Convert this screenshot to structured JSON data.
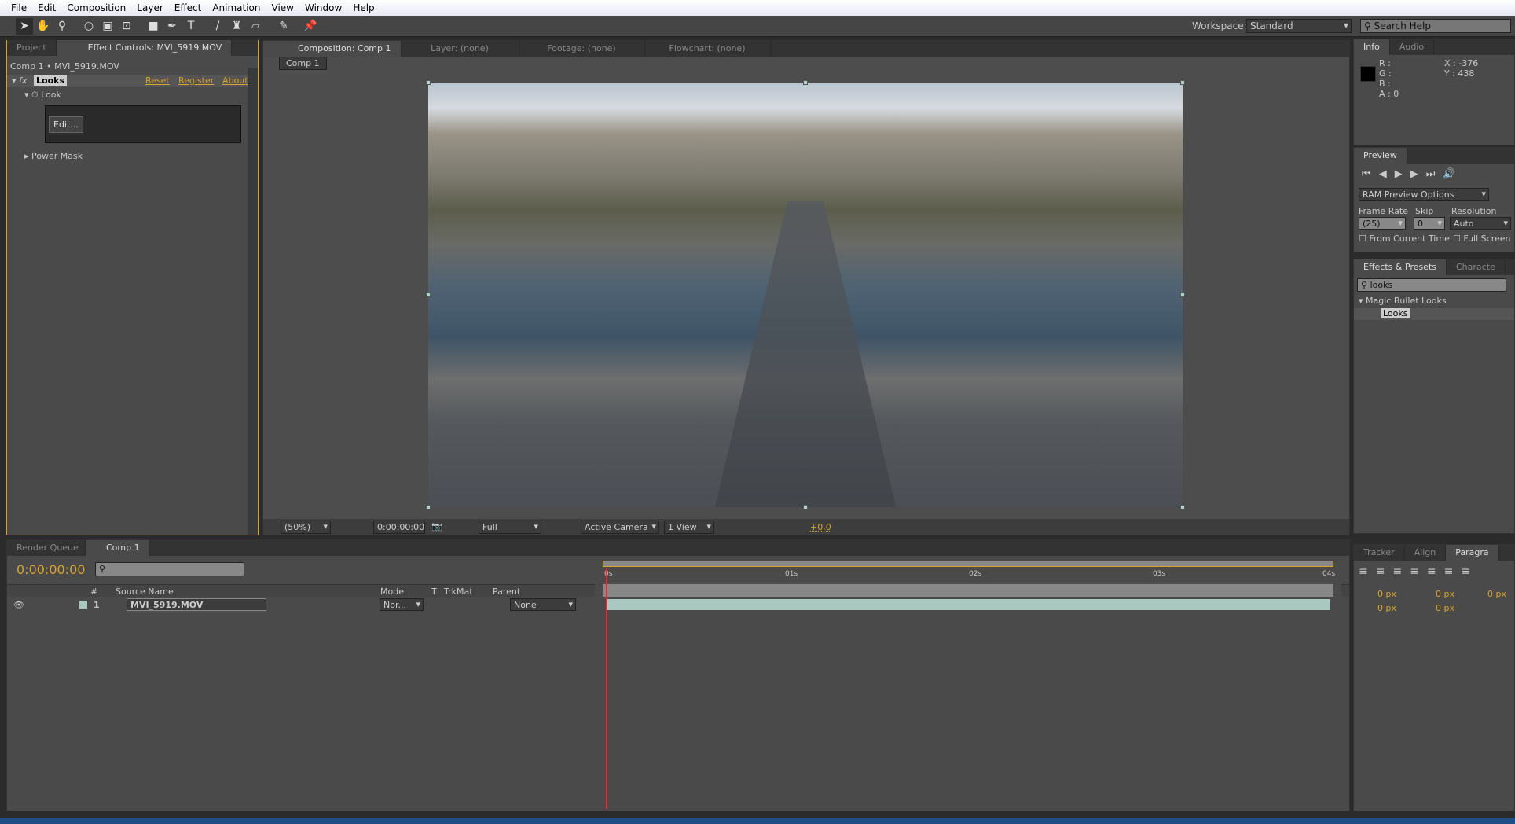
{
  "menu": [
    "File",
    "Edit",
    "Composition",
    "Layer",
    "Effect",
    "Animation",
    "View",
    "Window",
    "Help"
  ],
  "toolbar": {
    "tools": [
      "selection-tool",
      "hand-tool",
      "zoom-tool",
      "rotate-tool",
      "camera-tool",
      "pan-behind-tool",
      "rectangle-tool",
      "pen-tool",
      "type-tool",
      "brush-tool",
      "clone-stamp-tool",
      "eraser-tool",
      "roto-brush-tool",
      "puppet-pin-tool"
    ],
    "workspace_label": "Workspace:",
    "workspace_value": "Standard",
    "search_placeholder": "Search Help"
  },
  "effect_controls": {
    "tabs": [
      "Project",
      "Effect Controls: MVI_5919.MOV"
    ],
    "breadcrumb": "Comp 1 • MVI_5919.MOV",
    "effect_name": "Looks",
    "reset": "Reset",
    "register": "Register",
    "about": "About",
    "look_label": "Look",
    "edit_button": "Edit...",
    "power_mask": "Power Mask"
  },
  "composition": {
    "tabs": [
      "Composition: Comp 1",
      "Layer: (none)",
      "Footage: (none)",
      "Flowchart: (none)"
    ],
    "comp_chip": "Comp 1",
    "zoom": "(50%)",
    "timecode": "0:00:00:00",
    "resolution": "Full",
    "camera": "Active Camera",
    "views": "1 View",
    "exposure": "+0,0"
  },
  "info": {
    "tabs": [
      "Info",
      "Audio"
    ],
    "r": "R :",
    "g": "G :",
    "b": "B :",
    "a": "A : 0",
    "x": "X : -376",
    "y": "Y : 438",
    "swatch_color": "#000000"
  },
  "preview": {
    "tab": "Preview",
    "ram_options": "RAM Preview Options",
    "frame_rate_label": "Frame Rate",
    "skip_label": "Skip",
    "resolution_label": "Resolution",
    "frame_rate": "(25)",
    "skip": "0",
    "resolution": "Auto",
    "from_current_time": "From Current Time",
    "full_screen": "Full Screen"
  },
  "effects_presets": {
    "tabs": [
      "Effects & Presets",
      "Characte"
    ],
    "search": "looks",
    "category": "Magic Bullet Looks",
    "item": "Looks"
  },
  "paragraph": {
    "tabs": [
      "Tracker",
      "Align",
      "Paragra"
    ],
    "values": [
      "0 px",
      "0 px",
      "0 px",
      "0 px",
      "0 px"
    ]
  },
  "timeline": {
    "tabs": [
      "Render Queue",
      "Comp 1"
    ],
    "timecode": "0:00:00:00",
    "columns": {
      "num": "#",
      "source": "Source Name",
      "mode": "Mode",
      "t": "T",
      "trkmat": "TrkMat",
      "parent": "Parent"
    },
    "layers": [
      {
        "num": "1",
        "name": "MVI_5919.MOV",
        "mode": "Nor...",
        "parent": "None"
      }
    ],
    "ruler": [
      "0s",
      "01s",
      "02s",
      "03s",
      "04s"
    ]
  },
  "colors": {
    "accent": "#d7a32b",
    "layer_bar": "#a8c8c0",
    "playhead": "#e03030"
  }
}
